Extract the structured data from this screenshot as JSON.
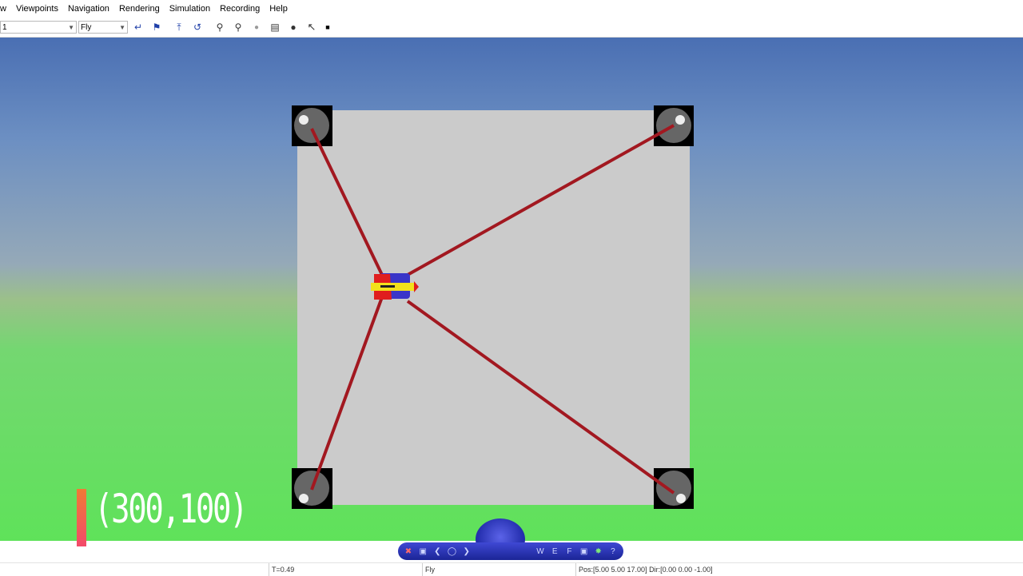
{
  "menu": [
    "w",
    "Viewpoints",
    "Navigation",
    "Rendering",
    "Simulation",
    "Recording",
    "Help"
  ],
  "toolbar": {
    "viewpoint_value": "1",
    "navigation_mode": "Fly",
    "icons": [
      "return-icon",
      "go-icon",
      "straighten-icon",
      "undo-move-icon",
      "zoom-in-icon",
      "zoom-out-icon",
      "record-dot-icon",
      "snapshot-list-icon",
      "camera-icon",
      "cursor-icon",
      "stop-icon"
    ]
  },
  "viewport": {
    "overlay_coord": "(300,100)"
  },
  "navdock": {
    "icons": [
      "close-icon",
      "minimize-icon",
      "back-arrow-icon",
      "orbit-icon",
      "forward-arrow-icon",
      "nav-wheel-icon",
      "walk-icon",
      "examine-icon",
      "fly-icon",
      "fit-icon",
      "lighting-icon",
      "help-icon"
    ],
    "labels": {
      "w": "W",
      "e": "E",
      "f": "F",
      "help": "?"
    }
  },
  "status": {
    "time": "T=0.49",
    "mode": "Fly",
    "pos": "Pos:[5.00 5.00 17.00] Dir:[0.00 0.00 -1.00]"
  },
  "colors": {
    "cable": "#a21820",
    "platform": "#cbcbcb",
    "sky": "#4a6fb3",
    "ground": "#5fe25a"
  }
}
